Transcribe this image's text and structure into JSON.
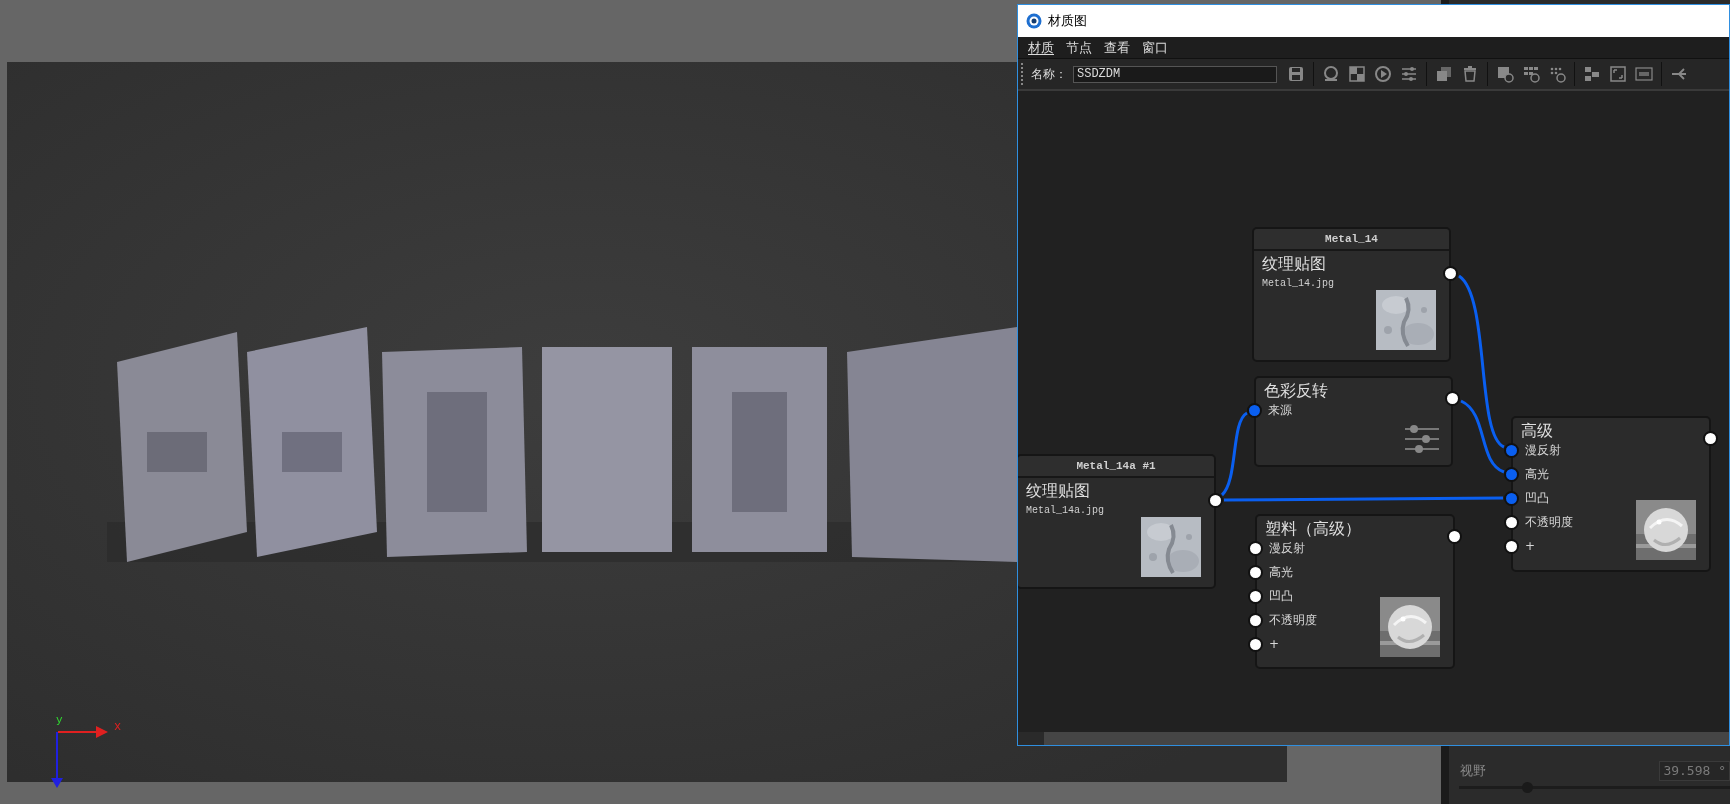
{
  "viewport": {
    "kind": "picture",
    "axes": {
      "x_label": "x",
      "y_label": "y"
    }
  },
  "window": {
    "title": "材质图"
  },
  "menu": [
    {
      "label": "材质",
      "underlined": true
    },
    {
      "label": "节点",
      "underlined": false
    },
    {
      "label": "查看",
      "underlined": false
    },
    {
      "label": "窗口",
      "underlined": false
    }
  ],
  "toolbar": {
    "name_label": "名称：",
    "name_value": "SSDZDM"
  },
  "nodes": [
    {
      "kind": "texture",
      "header": "Metal_14",
      "title": "纹理贴图",
      "file": "Metal_14.jpg"
    },
    {
      "kind": "filter",
      "title": "色彩反转",
      "ports": [
        {
          "label": "来源",
          "connected": true
        }
      ]
    },
    {
      "kind": "texture",
      "header": "Metal_14a #1",
      "title": "纹理贴图",
      "file": "Metal_14a.jpg"
    },
    {
      "kind": "material",
      "title": "塑料（高级）",
      "ports": [
        {
          "label": "漫反射",
          "connected": false
        },
        {
          "label": "高光",
          "connected": false
        },
        {
          "label": "凹凸",
          "connected": false
        },
        {
          "label": "不透明度",
          "connected": false
        },
        {
          "label": "+",
          "connected": false
        }
      ]
    },
    {
      "kind": "material",
      "title": "高级",
      "ports": [
        {
          "label": "漫反射",
          "connected": true
        },
        {
          "label": "高光",
          "connected": true
        },
        {
          "label": "凹凸",
          "connected": true
        },
        {
          "label": "不透明度",
          "connected": false
        },
        {
          "label": "+",
          "connected": false
        }
      ]
    }
  ],
  "side_panel": {
    "field_label": "视野",
    "field_value": "39.598 °",
    "level": 0.25
  }
}
